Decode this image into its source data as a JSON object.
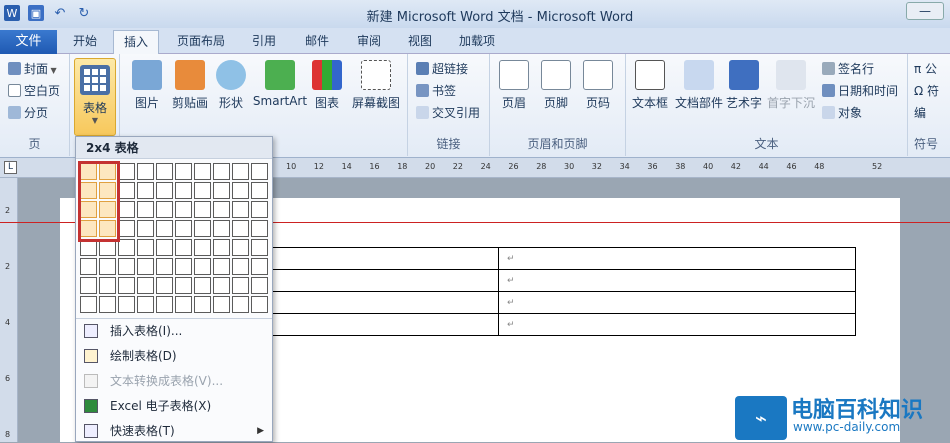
{
  "window": {
    "title": "新建 Microsoft Word 文档 - Microsoft Word",
    "control": "—"
  },
  "qat": {
    "app_icon": "W",
    "save_icon": "save-icon",
    "undo_icon": "↶",
    "redo_icon": "↻"
  },
  "tabs": {
    "file": "文件",
    "items": [
      "开始",
      "插入",
      "页面布局",
      "引用",
      "邮件",
      "审阅",
      "视图",
      "加载项"
    ],
    "active": "插入"
  },
  "ribbon": {
    "pages": {
      "label": "页",
      "items": [
        "封面",
        "空白页",
        "分页"
      ]
    },
    "tables": {
      "label": "表格"
    },
    "illustrations": {
      "items": [
        "图片",
        "剪贴画",
        "形状",
        "SmartArt",
        "图表",
        "屏幕截图"
      ]
    },
    "links": {
      "label": "链接",
      "items": [
        "超链接",
        "书签",
        "交叉引用"
      ]
    },
    "header_footer": {
      "label": "页眉和页脚",
      "items": [
        "页眉",
        "页脚",
        "页码"
      ]
    },
    "text": {
      "label": "文本",
      "items": [
        "文本框",
        "文档部件",
        "艺术字",
        "首字下沉"
      ],
      "small": [
        "签名行",
        "日期和时间",
        "对象"
      ]
    },
    "symbols": {
      "label": "符号",
      "items": [
        "π 公",
        "Ω 符",
        "编"
      ]
    }
  },
  "ruler": {
    "numbers": [
      "10",
      "12",
      "14",
      "16",
      "18",
      "20",
      "22",
      "24",
      "26",
      "28",
      "30",
      "32",
      "34",
      "36",
      "38",
      "40",
      "42",
      "44",
      "46",
      "48",
      "52"
    ],
    "vnumbers": [
      "2",
      "2",
      "4",
      "6",
      "8"
    ]
  },
  "table_panel": {
    "title": "2x4 表格",
    "rows": 8,
    "cols": 10,
    "selected_rows": 4,
    "selected_cols": 2,
    "menu": [
      {
        "label": "插入表格(I)...",
        "disabled": false
      },
      {
        "label": "绘制表格(D)",
        "disabled": false
      },
      {
        "label": "文本转换成表格(V)...",
        "disabled": true
      },
      {
        "label": "Excel 电子表格(X)",
        "disabled": false
      },
      {
        "label": "快速表格(T)",
        "disabled": false
      }
    ]
  },
  "document": {
    "cell_mark": "↵"
  },
  "watermark": {
    "title": "电脑百科知识",
    "url": "www.pc-daily.com"
  }
}
